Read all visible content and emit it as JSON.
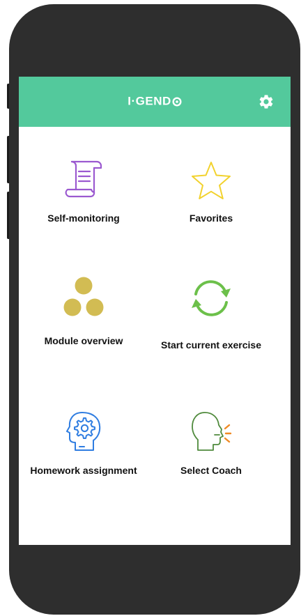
{
  "app": {
    "logo_text": "I·GEND",
    "logo_suffix_icon": "ring-o-icon",
    "header_color": "#53c99c",
    "settings_icon": "gear-icon"
  },
  "tiles": [
    {
      "label": "Self-monitoring",
      "icon": "scroll-icon",
      "color": "#9b59d0"
    },
    {
      "label": "Favorites",
      "icon": "star-icon",
      "color": "#f2d22e"
    },
    {
      "label": "Module overview",
      "icon": "three-dots-icon",
      "color": "#d2bc53"
    },
    {
      "label": "Start current exercise",
      "icon": "refresh-cycle-icon",
      "color": "#6cc04a"
    },
    {
      "label": "Homework assignment",
      "icon": "head-gear-icon",
      "color": "#2f7de1"
    },
    {
      "label": "Select Coach",
      "icon": "speaking-head-icon",
      "color": "#4f8a3c"
    }
  ]
}
